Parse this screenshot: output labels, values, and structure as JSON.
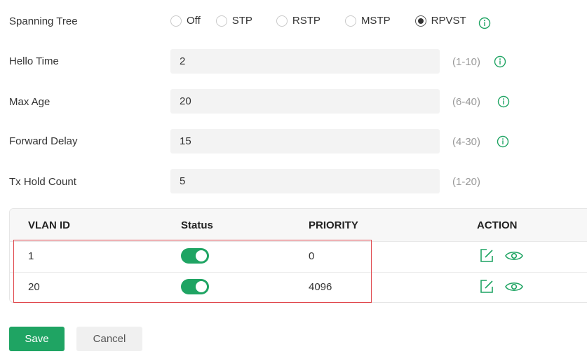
{
  "form": {
    "spanning_tree": {
      "label": "Spanning Tree",
      "options": [
        "Off",
        "STP",
        "RSTP",
        "MSTP",
        "RPVST"
      ],
      "selected": "RPVST"
    },
    "hello_time": {
      "label": "Hello Time",
      "value": "2",
      "range": "(1-10)"
    },
    "max_age": {
      "label": "Max Age",
      "value": "20",
      "range": "(6-40)"
    },
    "forward_delay": {
      "label": "Forward Delay",
      "value": "15",
      "range": "(4-30)"
    },
    "tx_hold_count": {
      "label": "Tx Hold Count",
      "value": "5",
      "range": "(1-20)"
    }
  },
  "table": {
    "headers": {
      "vlan_id": "VLAN ID",
      "status": "Status",
      "priority": "PRIORITY",
      "action": "ACTION"
    },
    "rows": [
      {
        "vlan_id": "1",
        "status_on": true,
        "priority": "0"
      },
      {
        "vlan_id": "20",
        "status_on": true,
        "priority": "4096"
      }
    ]
  },
  "buttons": {
    "save": "Save",
    "cancel": "Cancel"
  },
  "colors": {
    "accent": "#1fa463",
    "highlight": "#e0474c",
    "info_icon": "#1fa463"
  },
  "icons": {
    "info": "info-circle-icon",
    "edit": "edit-icon",
    "view": "eye-icon"
  }
}
